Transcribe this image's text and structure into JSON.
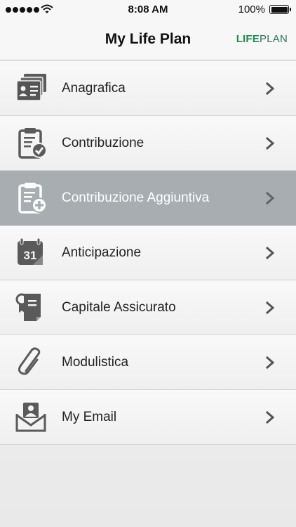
{
  "status_bar": {
    "time": "8:08 AM",
    "battery": "100%",
    "signal_icon": "signal-dots-icon",
    "wifi_icon": "wifi-icon",
    "battery_icon": "battery-icon"
  },
  "header": {
    "title": "My Life Plan",
    "logo_life": "LIFE",
    "logo_plan": "PLAN"
  },
  "colors": {
    "selected_row": "#a7adb1",
    "icon_gray": "#5a5a5a",
    "logo_green": "#1f8a4c"
  },
  "menu": {
    "items": [
      {
        "label": "Anagrafica",
        "icon": "id-cards-icon",
        "selected": false
      },
      {
        "label": "Contribuzione",
        "icon": "clipboard-check-icon",
        "selected": false
      },
      {
        "label": "Contribuzione Aggiuntiva",
        "icon": "clipboard-plus-icon",
        "selected": true
      },
      {
        "label": "Anticipazione",
        "icon": "calendar-31-icon",
        "selected": false
      },
      {
        "label": "Capitale Assicurato",
        "icon": "certificate-icon",
        "selected": false
      },
      {
        "label": "Modulistica",
        "icon": "paperclip-icon",
        "selected": false
      },
      {
        "label": "My Email",
        "icon": "email-inbox-icon",
        "selected": false
      }
    ],
    "calendar_number": "31"
  }
}
